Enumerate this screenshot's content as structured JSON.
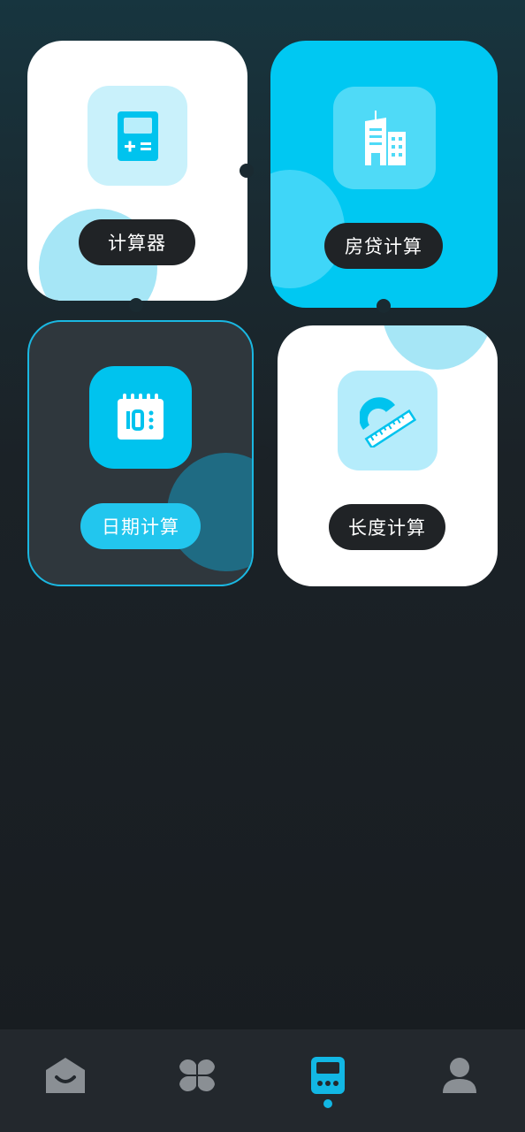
{
  "tools": [
    {
      "id": "calculator",
      "label": "计算器",
      "icon": "calculator-icon"
    },
    {
      "id": "mortgage",
      "label": "房贷计算",
      "icon": "buildings-icon"
    },
    {
      "id": "date",
      "label": "日期计算",
      "icon": "calendar-icon"
    },
    {
      "id": "length",
      "label": "长度计算",
      "icon": "ruler-protractor-icon"
    }
  ],
  "bottom_nav": {
    "items": [
      {
        "icon": "home-icon",
        "active": false
      },
      {
        "icon": "apps-icon",
        "active": false
      },
      {
        "icon": "calculator-tab-icon",
        "active": true
      },
      {
        "icon": "profile-icon",
        "active": false
      }
    ]
  },
  "colors": {
    "accent": "#00c8f2",
    "inactive": "#8a8f94",
    "card_dark": "#2f373d"
  }
}
